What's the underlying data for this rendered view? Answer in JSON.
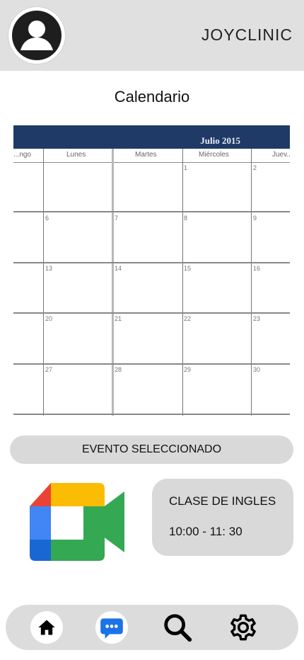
{
  "header": {
    "brand": "JOYCLINIC",
    "avatar_icon": "user-avatar-icon"
  },
  "page": {
    "title": "Calendario"
  },
  "calendar": {
    "month_label": "Julio 2015",
    "header_color": "#1f3a66",
    "weekdays": [
      "...ngo",
      "Lunes",
      "Martes",
      "Miércoles",
      "Juev..."
    ],
    "dates": [
      "1",
      "2",
      "6",
      "7",
      "8",
      "9",
      "13",
      "14",
      "15",
      "16",
      "20",
      "21",
      "22",
      "23",
      "27",
      "28",
      "29",
      "30"
    ]
  },
  "selected_event": {
    "label": "EVENTO SELECCIONADO",
    "app_icon": "google-meet-icon",
    "name": "CLASE DE INGLES",
    "time": "10:00 - 11: 30"
  },
  "nav": {
    "items": [
      {
        "icon": "home-icon"
      },
      {
        "icon": "chat-icon",
        "accent": "#1a73e8"
      },
      {
        "icon": "search-icon"
      },
      {
        "icon": "gear-icon"
      }
    ]
  },
  "colors": {
    "header_bg": "#e0e0e0",
    "card_bg": "#d9d9d9",
    "meet_blue": "#4285f4",
    "meet_red": "#ea4335",
    "meet_yellow": "#fbbc04",
    "meet_green": "#34a853"
  }
}
